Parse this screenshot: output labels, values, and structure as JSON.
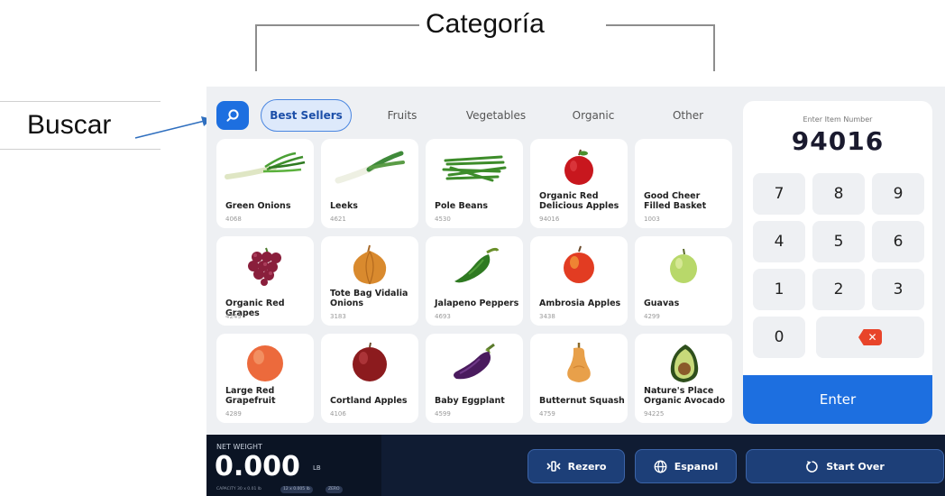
{
  "annotations": {
    "category_label": "Categoría",
    "search_label": "Buscar"
  },
  "categories": [
    {
      "label": "Best Sellers",
      "active": true
    },
    {
      "label": "Fruits",
      "active": false
    },
    {
      "label": "Vegetables",
      "active": false
    },
    {
      "label": "Organic",
      "active": false
    },
    {
      "label": "Other",
      "active": false
    }
  ],
  "products": [
    {
      "name": "Green Onions",
      "code": "4068",
      "image": "green-onions-icon"
    },
    {
      "name": "Leeks",
      "code": "4621",
      "image": "leeks-icon"
    },
    {
      "name": "Pole Beans",
      "code": "4530",
      "image": "pole-beans-icon"
    },
    {
      "name": "Organic Red Delicious Apples",
      "code": "94016",
      "image": "red-apple-icon"
    },
    {
      "name": "Good Cheer Filled Basket",
      "code": "1003",
      "image": ""
    },
    {
      "name": "Organic Red Grapes",
      "code": "4249",
      "image": "red-grapes-icon"
    },
    {
      "name": "Tote Bag Vidalia Onions",
      "code": "3183",
      "image": "onion-icon"
    },
    {
      "name": "Jalapeno Peppers",
      "code": "4693",
      "image": "jalapeno-icon"
    },
    {
      "name": "Ambrosia Apples",
      "code": "3438",
      "image": "ambrosia-apple-icon"
    },
    {
      "name": "Guavas",
      "code": "4299",
      "image": "guava-icon"
    },
    {
      "name": "Large Red Grapefruit",
      "code": "4289",
      "image": "grapefruit-icon"
    },
    {
      "name": "Cortland Apples",
      "code": "4106",
      "image": "cortland-apple-icon"
    },
    {
      "name": "Baby Eggplant",
      "code": "4599",
      "image": "eggplant-icon"
    },
    {
      "name": "Butternut Squash",
      "code": "4759",
      "image": "butternut-squash-icon"
    },
    {
      "name": "Nature's Place Organic Avocado",
      "code": "94225",
      "image": "avocado-icon"
    }
  ],
  "keypad": {
    "title": "Enter Item Number",
    "value": "94016",
    "keys": [
      "7",
      "8",
      "9",
      "4",
      "5",
      "6",
      "1",
      "2",
      "3",
      "0"
    ],
    "enter_label": "Enter"
  },
  "footer": {
    "net_weight_label": "NET WEIGHT",
    "net_weight_value": "0.000",
    "unit": "LB",
    "capacity": "CAPACITY 30 x 0.01 lb",
    "chip1": "12 x 0.005 lb",
    "chip2": "ZERO",
    "rezero_label": "Rezero",
    "espanol_label": "Espanol",
    "start_over_label": "Start Over"
  },
  "colors": {
    "accent": "#1d6fe0",
    "footer_bg": "#101c33",
    "delete": "#e8442a"
  }
}
